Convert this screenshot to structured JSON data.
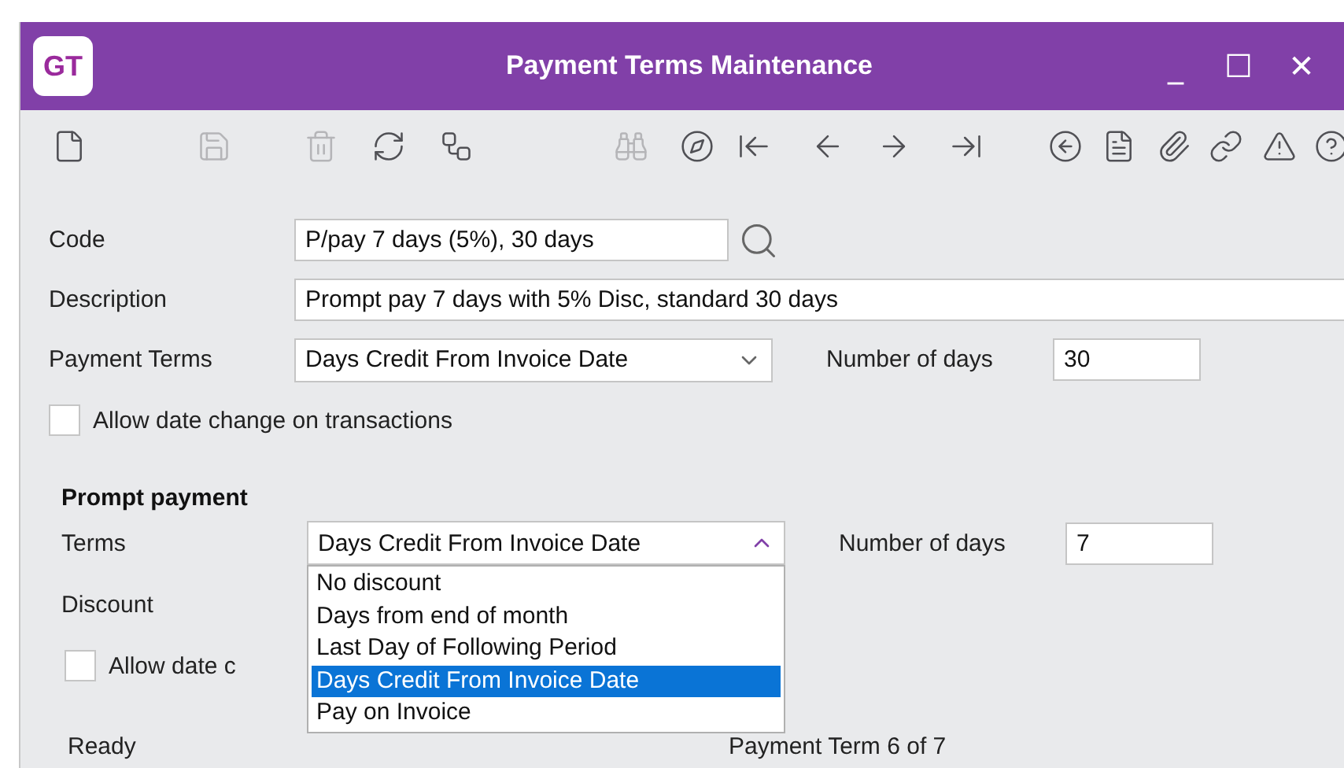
{
  "window": {
    "logo": "GT",
    "title": "Payment Terms Maintenance",
    "controls": [
      "_",
      "☐",
      "✕"
    ]
  },
  "toolbar": [
    {
      "disabled": false
    },
    {
      "disabled": true
    },
    {
      "disabled": true
    },
    {
      "disabled": false
    },
    {
      "disabled": false
    },
    {
      "disabled": true
    },
    {
      "disabled": false
    },
    {
      "disabled": false
    },
    {
      "disabled": false
    },
    {
      "disabled": false
    },
    {
      "disabled": false
    },
    {
      "disabled": false
    },
    {
      "disabled": false
    },
    {
      "disabled": false
    },
    {
      "disabled": false
    },
    {
      "disabled": false
    },
    {
      "disabled": false
    }
  ],
  "form": {
    "code": {
      "label": "Code",
      "value": "P/pay 7 days (5%), 30 days"
    },
    "description": {
      "label": "Description",
      "value": "Prompt pay 7 days with 5% Disc, standard 30 days"
    },
    "payment_terms": {
      "label": "Payment Terms",
      "value": "Days Credit From Invoice Date",
      "expanded": false
    },
    "number_of_days": {
      "label": "Number of days",
      "value": "30"
    },
    "allow_date_change": {
      "label": "Allow date change on transactions",
      "checked": false
    }
  },
  "prompt_payment": {
    "heading": "Prompt payment",
    "terms": {
      "label": "Terms",
      "value": "Days Credit From Invoice Date",
      "expanded": true,
      "options": [
        {
          "label": "No discount",
          "selected": false
        },
        {
          "label": "Days from end of month",
          "selected": false
        },
        {
          "label": "Last Day of Following Period",
          "selected": false
        },
        {
          "label": "Days Credit From Invoice Date",
          "selected": true
        },
        {
          "label": "Pay on Invoice",
          "selected": false
        }
      ]
    },
    "number_of_days": {
      "label": "Number of days",
      "value": "7"
    },
    "discount": {
      "label": "Discount"
    },
    "allow_date_change": {
      "label": "Allow date c",
      "checked": false
    }
  },
  "status_bar": {
    "status": "Ready",
    "record": "Payment Term 6 of 7"
  }
}
